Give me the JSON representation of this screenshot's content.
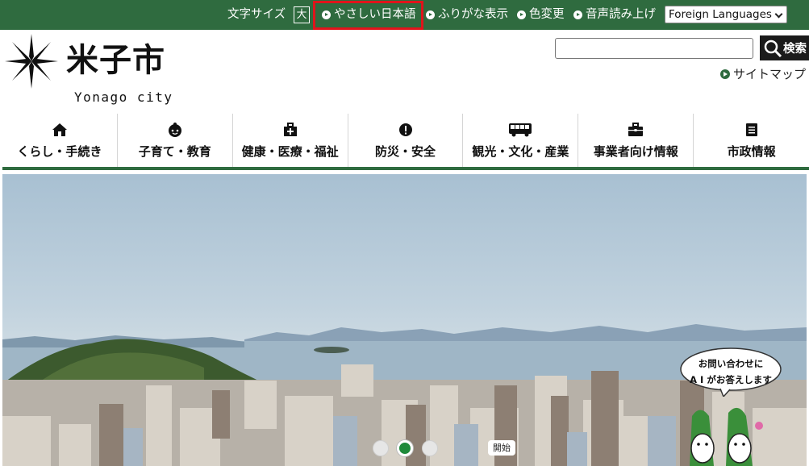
{
  "topbar": {
    "font_size_label": "文字サイズ",
    "font_size_large": "大",
    "easy_japanese": "やさしい日本語",
    "furigana": "ふりがな表示",
    "color_change": "色変更",
    "read_aloud": "音声読み上げ",
    "language_select": "Foreign Languages",
    "highlight_color": "#e0141b",
    "bar_color": "#2f6b3f"
  },
  "header": {
    "city_name": "米子市",
    "city_name_en": "Yonago city",
    "search_placeholder": "",
    "search_button": "検索",
    "sitemap": "サイトマップ"
  },
  "nav": {
    "items": [
      {
        "label": "くらし・手続き",
        "icon": "house-icon"
      },
      {
        "label": "子育て・教育",
        "icon": "child-face-icon"
      },
      {
        "label": "健康・医療・福祉",
        "icon": "medical-kit-icon"
      },
      {
        "label": "防災・安全",
        "icon": "alert-icon"
      },
      {
        "label": "観光・文化・産業",
        "icon": "bus-icon"
      },
      {
        "label": "事業者向け情報",
        "icon": "briefcase-icon"
      },
      {
        "label": "市政情報",
        "icon": "document-icon"
      }
    ]
  },
  "hero": {
    "slider_count": 3,
    "active_slide": 2,
    "start_button": "開始",
    "ai_chat_line1": "お問い合わせに",
    "ai_chat_line2": "A I がお答えします"
  }
}
